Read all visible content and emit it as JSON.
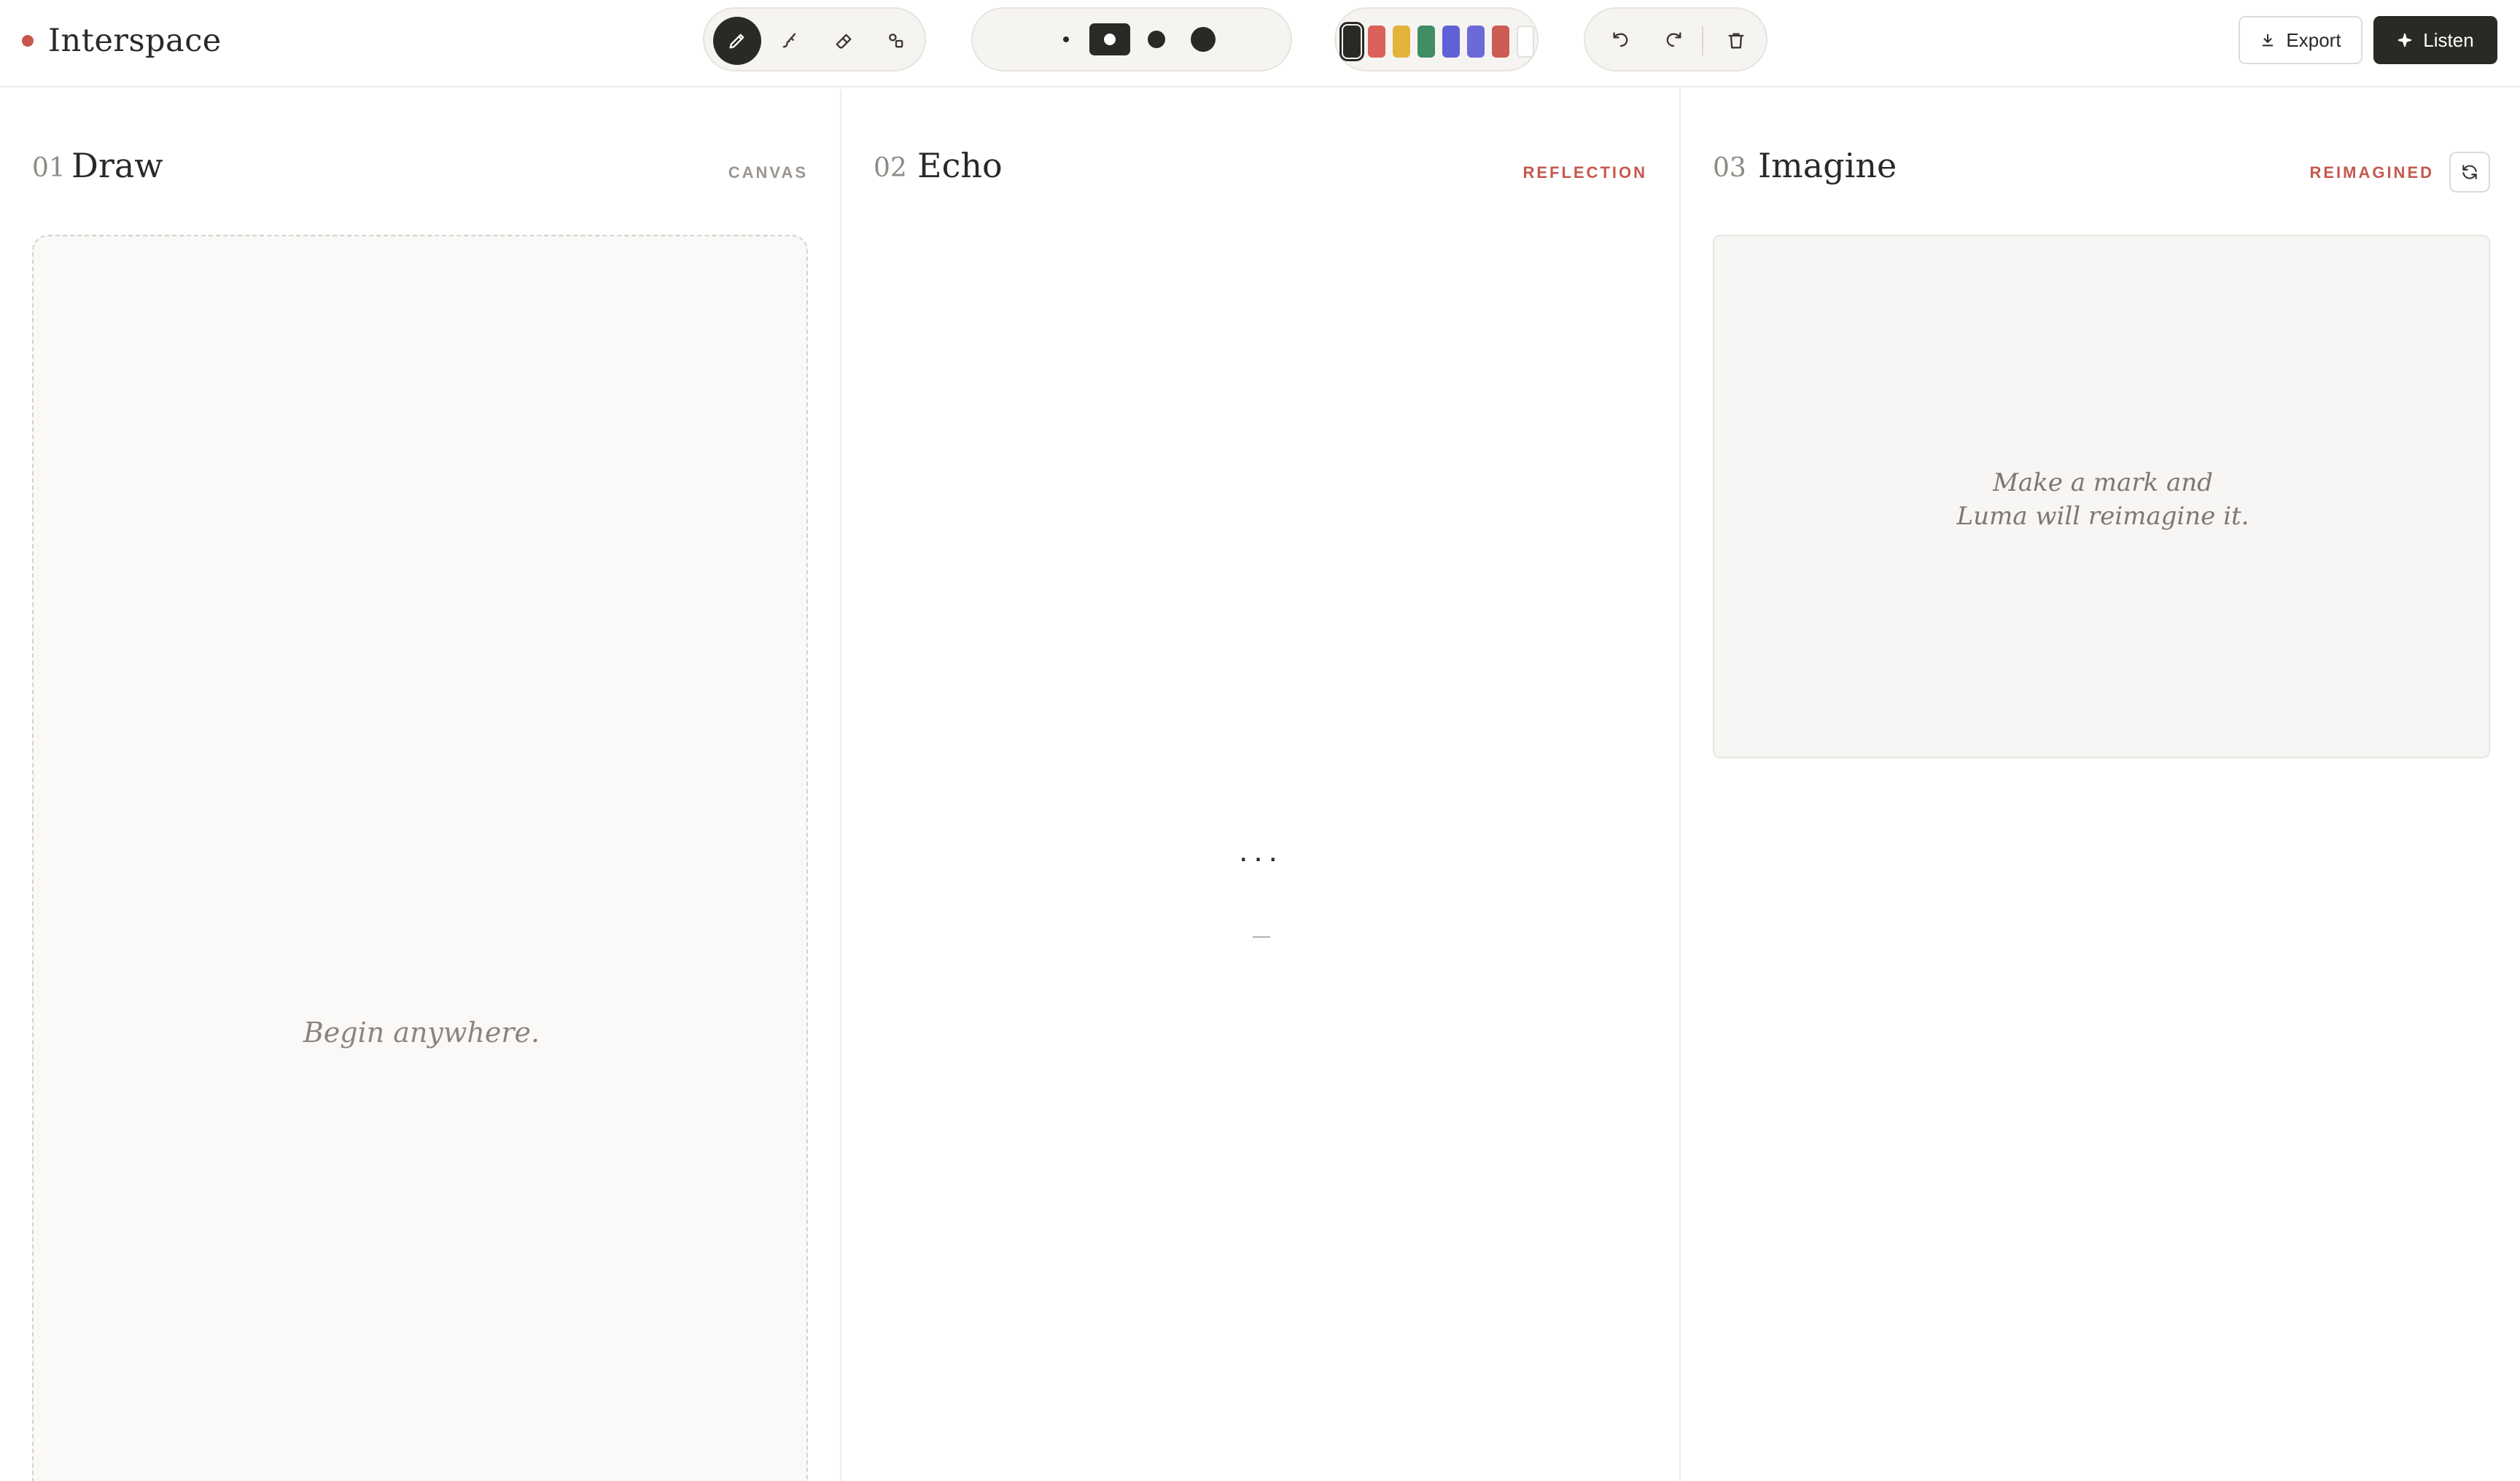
{
  "app": {
    "name": "Interspace",
    "accent": "#c7574d"
  },
  "toolbar": {
    "tools": [
      {
        "name": "pen",
        "active": true
      },
      {
        "name": "brush",
        "active": false
      },
      {
        "name": "eraser",
        "active": false
      },
      {
        "name": "shapes",
        "active": false
      }
    ],
    "brush_sizes": [
      {
        "size": "xs",
        "active": false
      },
      {
        "size": "s",
        "active": true
      },
      {
        "size": "m",
        "active": false
      },
      {
        "size": "l",
        "active": false
      }
    ],
    "colors": [
      {
        "hex": "#2b2926",
        "active": true
      },
      {
        "hex": "#d9615a",
        "active": false
      },
      {
        "hex": "#e3b43c",
        "active": false
      },
      {
        "hex": "#3f8e64",
        "active": false
      },
      {
        "hex": "#5f62d6",
        "active": false
      },
      {
        "hex": "#6a6ad9",
        "active": false
      },
      {
        "hex": "#cc5c54",
        "active": false
      },
      {
        "hex": "#ffffff",
        "active": false
      }
    ],
    "history": [
      "undo-icon",
      "redo-icon",
      "trash-icon"
    ],
    "export_label": "Export",
    "listen_label": "Listen"
  },
  "columns": {
    "draw": {
      "num": "01",
      "title": "Draw",
      "tag": "CANVAS",
      "hint": "Begin anywhere."
    },
    "echo": {
      "num": "02",
      "title": "Echo",
      "tag": "REFLECTION",
      "status": "..."
    },
    "imagine": {
      "num": "03",
      "title": "Imagine",
      "tag": "REIMAGINED",
      "hint_line1": "Make a mark and",
      "hint_line2": "Luma will reimagine it."
    }
  }
}
